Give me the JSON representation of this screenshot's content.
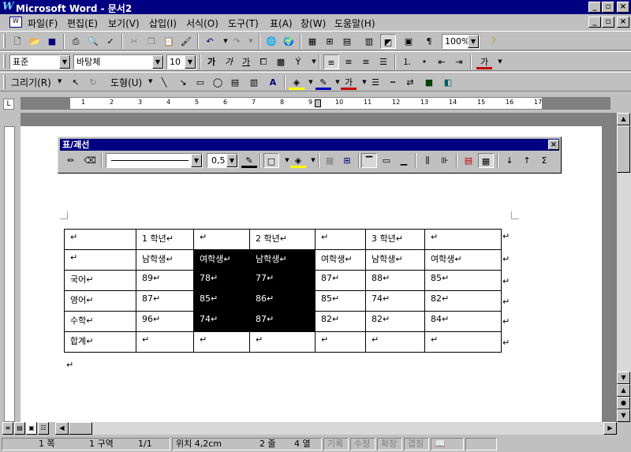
{
  "window": {
    "title": "Microsoft Word - 문서2"
  },
  "menu": [
    "파일(F)",
    "편집(E)",
    "보기(V)",
    "삽입(I)",
    "서식(O)",
    "도구(T)",
    "표(A)",
    "창(W)",
    "도움말(H)"
  ],
  "toolbar_standard": {
    "zoom": "100%"
  },
  "toolbar_format": {
    "style": "표준",
    "font": "바탕체",
    "size": "10",
    "bold": "가",
    "italic": "가",
    "underline": "가",
    "font_color": "가"
  },
  "toolbar_drawing": {
    "draw": "그리기(R)",
    "autoshape": "도형(U)"
  },
  "tables_palette": {
    "title": "표/괘선",
    "line_weight": "0,5"
  },
  "ruler": {
    "numbers": [
      "1",
      "2",
      "3",
      "4",
      "5",
      "6",
      "7",
      "8",
      "9",
      "10",
      "11",
      "12",
      "13",
      "14",
      "15",
      "16",
      "17"
    ]
  },
  "table": {
    "rows": [
      [
        "↵",
        "1 학년↵",
        "↵",
        "2 학년↵",
        "↵",
        "3 학년↵",
        "↵"
      ],
      [
        "↵",
        "남학생↵",
        "여학생↵",
        "남학생↵",
        "여학생↵",
        "남학생↵",
        "여학생↵"
      ],
      [
        "국어↵",
        "89↵",
        "78↵",
        "77↵",
        "87↵",
        "88↵",
        "85↵"
      ],
      [
        "영어↵",
        "87↵",
        "85↵",
        "86↵",
        "85↵",
        "74↵",
        "82↵"
      ],
      [
        "수학↵",
        "96↵",
        "74↵",
        "87↵",
        "82↵",
        "82↵",
        "84↵"
      ],
      [
        "합계↵",
        "↵",
        "↵",
        "↵",
        "↵",
        "↵",
        "↵"
      ]
    ],
    "end_of_row": "↵",
    "after_table": "↵"
  },
  "status": {
    "page": "1 쪽",
    "section": "1 구역",
    "pages": "1/1",
    "position": "위치 4,2cm",
    "line": "2 줄",
    "column": "4 열",
    "rec": "기록",
    "trk": "수정",
    "ext": "확장",
    "ovr": "겹침"
  }
}
